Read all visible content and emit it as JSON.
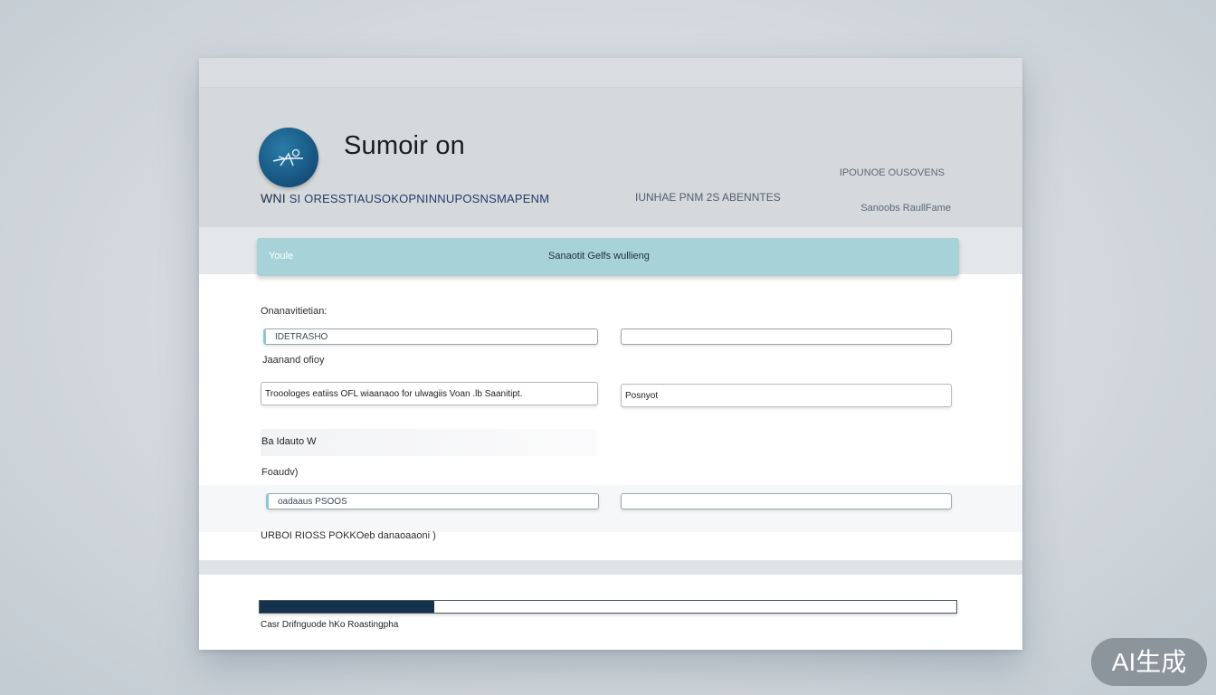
{
  "header": {
    "app_title": "Sumoir on",
    "subtitle_lead": "WNI",
    "subtitle_rest": "SI ORESSTIAUSOKOPNINNUPOSNSMAPENM",
    "middle_text": "IUNHAE PNM 2S ABENNTES",
    "right_top": "IPOUNOE OUSOVENS",
    "right_bottom": "Sanoobs RaullFame"
  },
  "banner": {
    "left_text": "Youle",
    "center_text": "Sanaotit Gelfs wullieng"
  },
  "form": {
    "section_label": "Onanavitietian:",
    "field1_value": "IDETRASHO",
    "label_2": "Jaanand ofioy",
    "field3_value": "Trooologes eatiiss OFL wiaanaoo  for  ulwagiis  Voan  .lb Saanitipt.",
    "field4_value": "Posnyot",
    "ghost_label": "Ba Idauto W",
    "label_5": "Foaudv)",
    "field5_value": "oadaaus PSOOS",
    "footer_label": "URBOI RIOSS POKKOeb danaoaaoni )"
  },
  "progress": {
    "value_percent": 25,
    "label": "Casr Drifnguode hKo Roastingpha"
  },
  "watermark": {
    "text": "AI生成"
  }
}
